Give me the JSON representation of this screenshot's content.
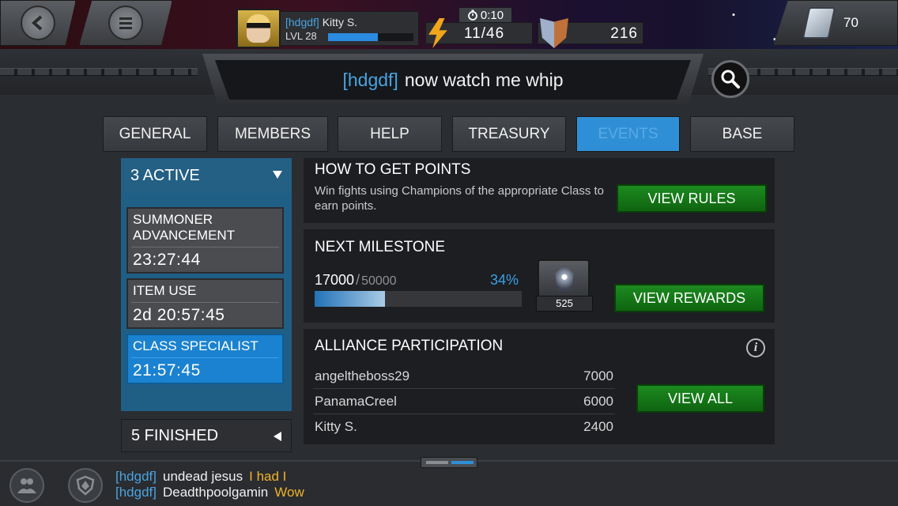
{
  "header": {
    "profile": {
      "tag": "[hdgdf]",
      "name": "Kitty S.",
      "level": "LVL 28",
      "xp_fraction": 0.58
    },
    "timer": "0:10",
    "energy": "11/46",
    "shield_value": "216",
    "cards_count": "70"
  },
  "banner": {
    "tag": "[hdgdf]",
    "message": "now watch me  whip"
  },
  "tabs": [
    {
      "label": "GENERAL",
      "active": false
    },
    {
      "label": "MEMBERS",
      "active": false
    },
    {
      "label": "HELP",
      "active": false
    },
    {
      "label": "TREASURY",
      "active": false
    },
    {
      "label": "EVENTS",
      "active": true
    },
    {
      "label": "BASE",
      "active": false
    }
  ],
  "events": {
    "active_header": "3 ACTIVE",
    "items": [
      {
        "name": "SUMMONER ADVANCEMENT",
        "time": "23:27:44",
        "selected": false
      },
      {
        "name": "ITEM USE",
        "time": "2d 20:57:45",
        "selected": false
      },
      {
        "name": "CLASS SPECIALIST",
        "time": "21:57:45",
        "selected": true
      }
    ],
    "finished_header": "5 FINISHED"
  },
  "how_to": {
    "title": "HOW TO GET POINTS",
    "description": "Win fights using Champions of the appropriate Class to earn points.",
    "button": "VIEW RULES"
  },
  "milestone": {
    "title": "NEXT MILESTONE",
    "current": "17000",
    "separator": "/",
    "target": "50000",
    "percent": "34%",
    "progress_fraction": 0.34,
    "reward_count": "525",
    "button": "VIEW REWARDS"
  },
  "participation": {
    "title": "ALLIANCE PARTICIPATION",
    "rows": [
      {
        "name": "angeltheboss29",
        "points": "7000"
      },
      {
        "name": "PanamaCreel",
        "points": "6000"
      },
      {
        "name": "Kitty S.",
        "points": "2400"
      }
    ],
    "button": "VIEW ALL"
  },
  "chat": [
    {
      "tag": "[hdgdf]",
      "user": "undead jesus",
      "message": "I had I"
    },
    {
      "tag": "[hdgdf]",
      "user": "Deadthpoolgamin",
      "message": "Wow"
    }
  ]
}
